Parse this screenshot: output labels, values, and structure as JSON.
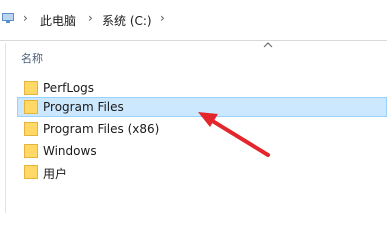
{
  "breadcrumb": {
    "items": [
      "此电脑",
      "系统 (C:)"
    ],
    "separator": "›"
  },
  "columns": {
    "name_header": "名称"
  },
  "files": [
    {
      "name": "PerfLogs",
      "selected": false
    },
    {
      "name": "Program Files",
      "selected": true
    },
    {
      "name": "Program Files (x86)",
      "selected": false
    },
    {
      "name": "Windows",
      "selected": false
    },
    {
      "name": "用户",
      "selected": false
    }
  ],
  "colors": {
    "selection_bg": "#cce8ff",
    "selection_border": "#99d1ff",
    "folder_yellow": "#ffd866",
    "annotation_arrow": "#e3262b"
  },
  "icons": {
    "address_bar": "this-pc-icon",
    "scroll": "chevron-up-icon",
    "file": "folder-icon"
  }
}
